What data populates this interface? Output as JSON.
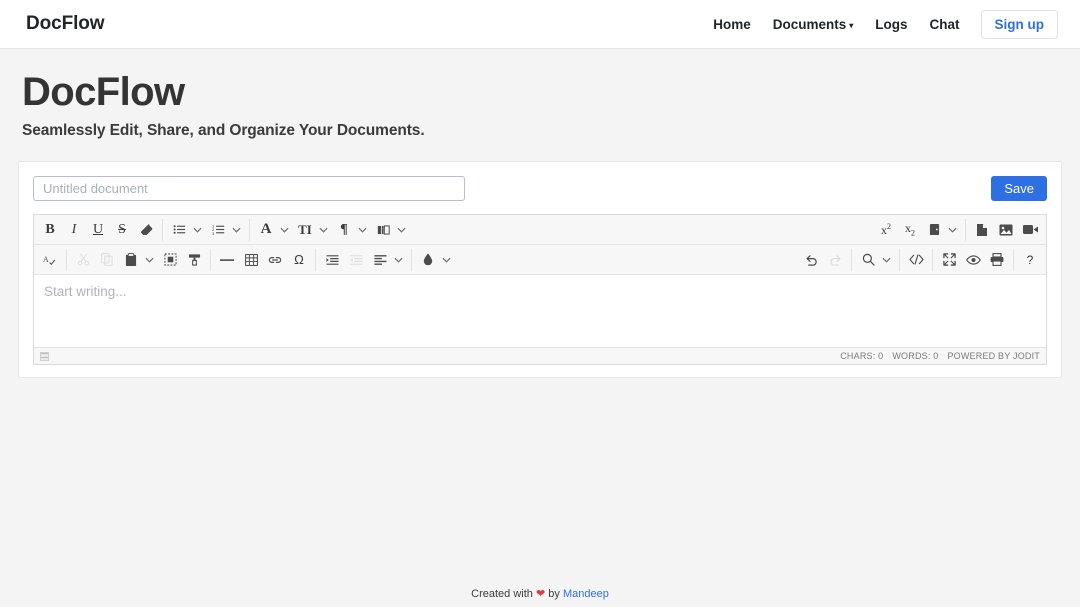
{
  "navbar": {
    "brand": "DocFlow",
    "links": [
      {
        "label": "Home",
        "icon": ""
      },
      {
        "label": "Documents",
        "icon": "caret-down-icon"
      },
      {
        "label": "Logs",
        "icon": ""
      },
      {
        "label": "Chat",
        "icon": ""
      }
    ],
    "caret": "▾",
    "signup_label": "Sign up",
    "signup_color": "#2f6fe4"
  },
  "hero": {
    "title": "DocFlow",
    "subtitle": "Seamlessly Edit, Share, and Organize Your Documents."
  },
  "editor": {
    "title_placeholder": "Untitled document",
    "title_value": "",
    "save_label": "Save",
    "save_color": "#2f6fe4",
    "content_placeholder": "Start writing...",
    "status": {
      "chars": "CHARS: 0",
      "words": "WORDS: 0",
      "powered": "POWERED BY JODIT"
    },
    "toolbar_row1": [
      {
        "name": "bold-icon",
        "glyph": "B"
      },
      {
        "name": "italic-icon",
        "glyph": "I"
      },
      {
        "name": "underline-icon",
        "glyph": "U"
      },
      {
        "name": "strikethrough-icon",
        "glyph": "S"
      },
      {
        "name": "eraser-icon",
        "glyph": ""
      },
      {
        "name": "unordered-list-icon",
        "glyph": ""
      },
      {
        "name": "ordered-list-icon",
        "glyph": ""
      },
      {
        "name": "font-family-icon",
        "glyph": "A"
      },
      {
        "name": "font-size-icon",
        "glyph": "TI"
      },
      {
        "name": "paragraph-icon",
        "glyph": "¶"
      },
      {
        "name": "class-span-icon",
        "glyph": ""
      },
      {
        "name": "superscript-icon",
        "glyph": "x2"
      },
      {
        "name": "subscript-icon",
        "glyph": "x2"
      },
      {
        "name": "copy-format-icon",
        "glyph": ""
      },
      {
        "name": "insert-file-icon",
        "glyph": ""
      },
      {
        "name": "insert-image-icon",
        "glyph": ""
      },
      {
        "name": "insert-video-icon",
        "glyph": ""
      }
    ],
    "toolbar_row2": [
      {
        "name": "spellcheck-icon",
        "glyph": ""
      },
      {
        "name": "cut-icon",
        "glyph": ""
      },
      {
        "name": "copy-icon",
        "glyph": ""
      },
      {
        "name": "paste-icon",
        "glyph": ""
      },
      {
        "name": "select-all-icon",
        "glyph": ""
      },
      {
        "name": "format-brush-icon",
        "glyph": ""
      },
      {
        "name": "horizontal-rule-icon",
        "glyph": ""
      },
      {
        "name": "table-icon",
        "glyph": ""
      },
      {
        "name": "link-icon",
        "glyph": ""
      },
      {
        "name": "symbol-icon",
        "glyph": "Ω"
      },
      {
        "name": "indent-icon",
        "glyph": ""
      },
      {
        "name": "outdent-icon",
        "glyph": ""
      },
      {
        "name": "align-icon",
        "glyph": ""
      },
      {
        "name": "brush-color-icon",
        "glyph": ""
      },
      {
        "name": "undo-icon",
        "glyph": ""
      },
      {
        "name": "redo-icon",
        "glyph": ""
      },
      {
        "name": "find-icon",
        "glyph": ""
      },
      {
        "name": "source-code-icon",
        "glyph": "</>"
      },
      {
        "name": "fullscreen-icon",
        "glyph": ""
      },
      {
        "name": "preview-icon",
        "glyph": ""
      },
      {
        "name": "print-icon",
        "glyph": ""
      },
      {
        "name": "help-icon",
        "glyph": "?"
      }
    ]
  },
  "footer": {
    "prefix": "Created with",
    "heart": "❤",
    "middle": "by",
    "author": "Mandeep"
  }
}
